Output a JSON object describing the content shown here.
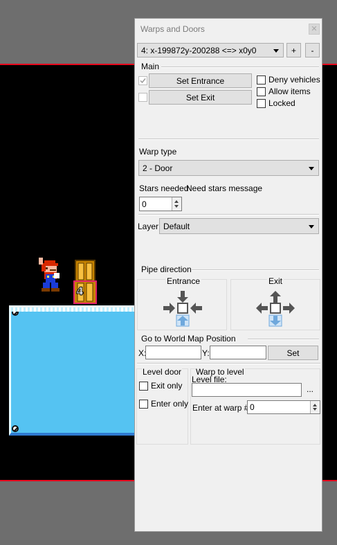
{
  "window": {
    "title": "Warps and Doors",
    "close_icon": "close-icon"
  },
  "warp_selector": {
    "selected": "4: x-199872y-200288 <=> x0y0",
    "add_label": "+",
    "remove_label": "-"
  },
  "main": {
    "section_label": "Main",
    "set_entrance_label": "Set Entrance",
    "set_exit_label": "Set Exit",
    "entrance_checked": true,
    "exit_checked": false,
    "deny_vehicles_label": "Deny vehicles",
    "allow_items_label": "Allow items",
    "locked_label": "Locked"
  },
  "warp_type": {
    "label": "Warp type",
    "selected": "2 - Door"
  },
  "stars": {
    "needed_label": "Stars needed",
    "message_label": "Need stars message",
    "value": "0"
  },
  "layer": {
    "label": "Layer:",
    "selected": "Default"
  },
  "pipe_direction": {
    "section_label": "Pipe direction",
    "entrance_label": "Entrance",
    "exit_label": "Exit",
    "entrance_selected": "down",
    "exit_selected": "down"
  },
  "world_map": {
    "section_label": "Go to World Map Position",
    "x_label": "X:",
    "y_label": "Y:",
    "x_value": "",
    "y_value": "",
    "set_label": "Set"
  },
  "level_door": {
    "section_label": "Level door",
    "exit_only_label": "Exit only",
    "enter_only_label": "Enter only"
  },
  "warp_to_level": {
    "section_label": "Warp to level",
    "level_file_label": "Level file:",
    "level_file_value": "",
    "browse_label": "...",
    "enter_at_warp_label": "Enter at warp #",
    "enter_at_warp_value": "0"
  },
  "colors": {
    "accent_checked": "#9a9a9a",
    "selected_arrow": "#6fa8dc",
    "water": "#55c3f2",
    "boundary": "#e8001c"
  }
}
